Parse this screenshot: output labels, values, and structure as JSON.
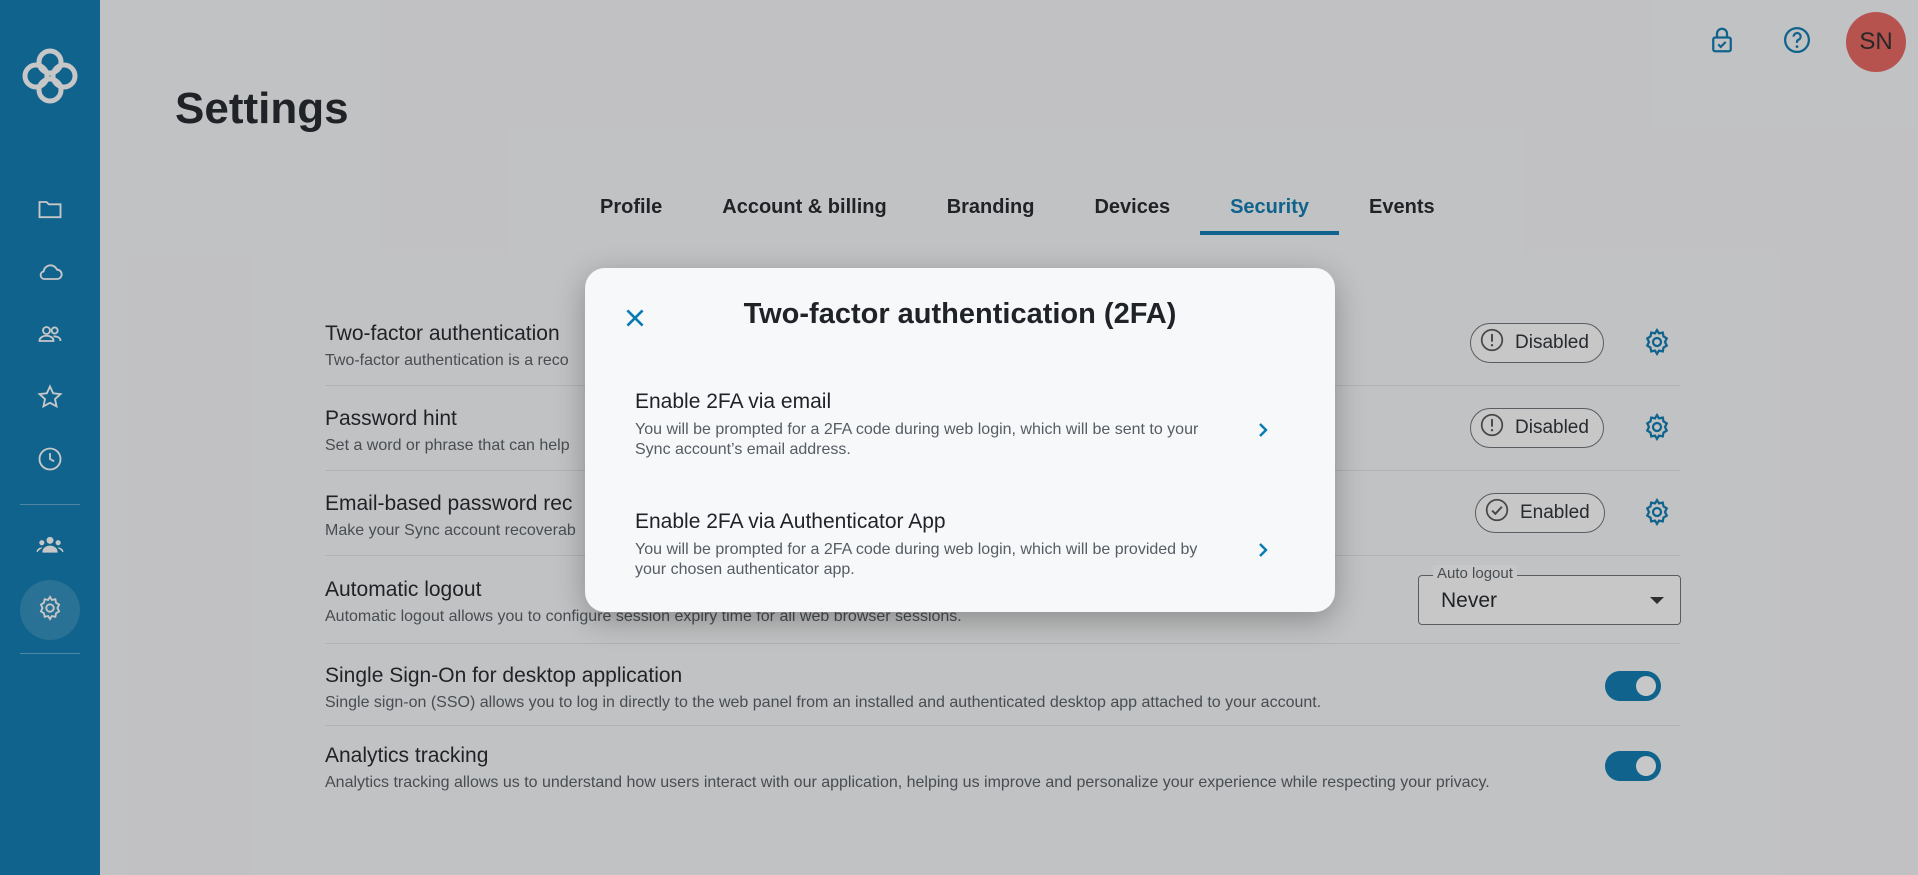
{
  "app": {
    "title": "Settings",
    "avatar_initials": "SN",
    "accent_color": "#0a7ab2",
    "avatar_color": "#e9655f"
  },
  "sidebar": {
    "logo": "sync-logo",
    "items": [
      {
        "name": "files",
        "icon": "folder-icon"
      },
      {
        "name": "cloud",
        "icon": "cloud-icon"
      },
      {
        "name": "shared",
        "icon": "users-icon"
      },
      {
        "name": "favorites",
        "icon": "star-icon"
      },
      {
        "name": "recent",
        "icon": "clock-icon"
      },
      {
        "name": "team",
        "icon": "team-icon"
      },
      {
        "name": "settings",
        "icon": "gear-icon",
        "active": true
      }
    ]
  },
  "header": {
    "icons": [
      "security-lock-icon",
      "help-icon"
    ]
  },
  "tabs": [
    {
      "label": "Profile"
    },
    {
      "label": "Account & billing"
    },
    {
      "label": "Branding"
    },
    {
      "label": "Devices"
    },
    {
      "label": "Security",
      "active": true
    },
    {
      "label": "Events"
    }
  ],
  "settings": {
    "two_factor": {
      "title": "Two-factor authentication",
      "desc": "Two-factor authentication is a reco",
      "status": "Disabled"
    },
    "password_hint": {
      "title": "Password hint",
      "desc": "Set a word or phrase that can help",
      "status": "Disabled"
    },
    "email_recovery": {
      "title": "Email-based password rec",
      "desc": "Make your Sync account recoverab",
      "status": "Enabled"
    },
    "auto_logout": {
      "title": "Automatic logout",
      "desc": "Automatic logout allows you to configure session expiry time for all web browser sessions.",
      "select_label": "Auto logout",
      "select_value": "Never"
    },
    "sso": {
      "title": "Single Sign-On for desktop application",
      "desc": "Single sign-on (SSO) allows you to log in directly to the web panel from an installed and authenticated desktop app attached to your account.",
      "enabled": true
    },
    "analytics": {
      "title": "Analytics tracking",
      "desc": "Analytics tracking allows us to understand how users interact with our application, helping us improve and personalize your experience while respecting your privacy.",
      "enabled": true
    }
  },
  "modal": {
    "title": "Two-factor authentication (2FA)",
    "options": [
      {
        "title": "Enable 2FA via email",
        "desc": "You will be prompted for a 2FA code during web login, which will be sent to your Sync account’s email address."
      },
      {
        "title": "Enable 2FA via Authenticator App",
        "desc": "You will be prompted for a 2FA code during web login, which will be provided by your chosen authenticator app."
      }
    ]
  }
}
